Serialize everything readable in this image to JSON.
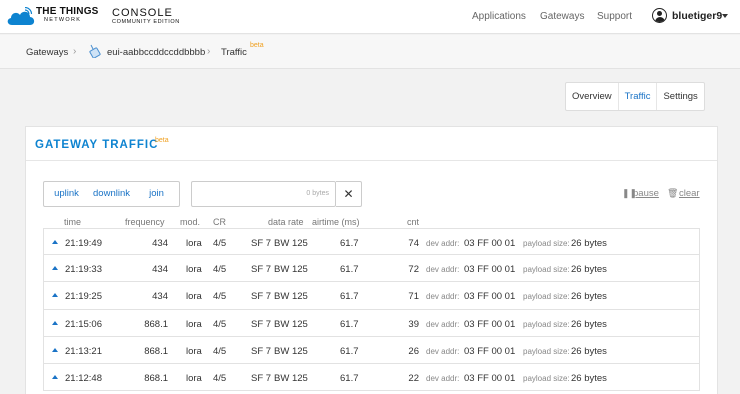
{
  "brand": {
    "line1": "THE THINGS",
    "line2": "NETWORK",
    "console": "CONSOLE",
    "edition": "COMMUNITY EDITION",
    "accent": "#0d83d0"
  },
  "nav": {
    "links": [
      "Applications",
      "Gateways",
      "Support"
    ],
    "username": "bluetiger9"
  },
  "breadcrumb": {
    "root": "Gateways",
    "gateway": "eui-aabbccddccddbbbb",
    "page": "Traffic",
    "badge": "beta"
  },
  "tabs": [
    "Overview",
    "Traffic",
    "Settings"
  ],
  "panel": {
    "title": "GATEWAY TRAFFIC",
    "badge": "beta"
  },
  "filters": [
    "uplink",
    "downlink",
    "join"
  ],
  "search": {
    "bytes": "0 bytes",
    "clear_icon": "✕"
  },
  "controls": {
    "pause": "pause",
    "clear": "clear"
  },
  "columns": [
    "time",
    "frequency",
    "mod.",
    "CR",
    "data rate",
    "airtime (ms)",
    "cnt"
  ],
  "row_labels": {
    "dev_addr": "dev addr:",
    "payload": "payload size:"
  },
  "rows": [
    {
      "time": "21:19:49",
      "frequency": "434",
      "mod": "lora",
      "cr": "4/5",
      "sf": "SF 7",
      "bw": "BW 125",
      "airtime": "61.7",
      "cnt": "74",
      "dev_addr": "03 FF 00 01",
      "payload": "26 bytes"
    },
    {
      "time": "21:19:33",
      "frequency": "434",
      "mod": "lora",
      "cr": "4/5",
      "sf": "SF 7",
      "bw": "BW 125",
      "airtime": "61.7",
      "cnt": "72",
      "dev_addr": "03 FF 00 01",
      "payload": "26 bytes"
    },
    {
      "time": "21:19:25",
      "frequency": "434",
      "mod": "lora",
      "cr": "4/5",
      "sf": "SF 7",
      "bw": "BW 125",
      "airtime": "61.7",
      "cnt": "71",
      "dev_addr": "03 FF 00 01",
      "payload": "26 bytes"
    },
    {
      "time": "21:15:06",
      "frequency": "868.1",
      "mod": "lora",
      "cr": "4/5",
      "sf": "SF 7",
      "bw": "BW 125",
      "airtime": "61.7",
      "cnt": "39",
      "dev_addr": "03 FF 00 01",
      "payload": "26 bytes"
    },
    {
      "time": "21:13:21",
      "frequency": "868.1",
      "mod": "lora",
      "cr": "4/5",
      "sf": "SF 7",
      "bw": "BW 125",
      "airtime": "61.7",
      "cnt": "26",
      "dev_addr": "03 FF 00 01",
      "payload": "26 bytes"
    },
    {
      "time": "21:12:48",
      "frequency": "868.1",
      "mod": "lora",
      "cr": "4/5",
      "sf": "SF 7",
      "bw": "BW 125",
      "airtime": "61.7",
      "cnt": "22",
      "dev_addr": "03 FF 00 01",
      "payload": "26 bytes"
    }
  ]
}
